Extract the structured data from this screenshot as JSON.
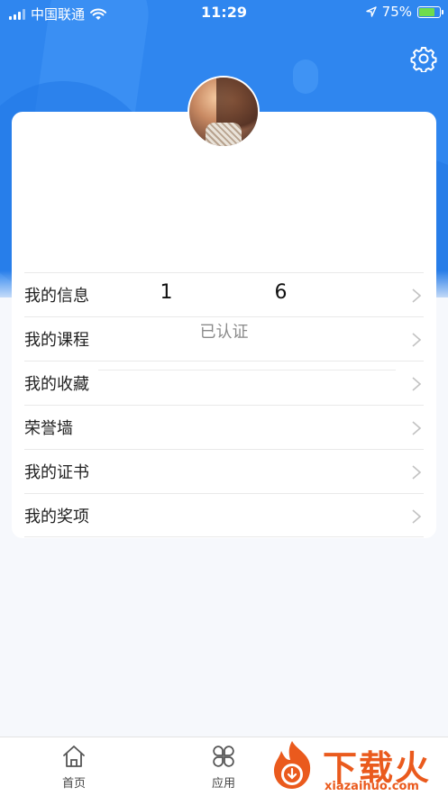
{
  "status_bar": {
    "carrier": "中国联通",
    "time": "11:29",
    "battery_percent": "75%",
    "battery_level": 0.75
  },
  "profile": {
    "phone_prefix": "1",
    "phone_suffix": "6",
    "verified_label": "已认证"
  },
  "menu": {
    "items": [
      {
        "label": "我的信息"
      },
      {
        "label": "我的课程"
      },
      {
        "label": "我的收藏"
      },
      {
        "label": "荣誉墙"
      },
      {
        "label": "我的证书"
      },
      {
        "label": "我的奖项"
      }
    ]
  },
  "tabbar": {
    "home_label": "首页",
    "apps_label": "应用"
  },
  "watermark": {
    "cn_text": "下载火",
    "en_text": "xiazaihuo.com"
  },
  "colors": {
    "primary": "#2f86ef",
    "watermark": "#ea5a1d"
  }
}
